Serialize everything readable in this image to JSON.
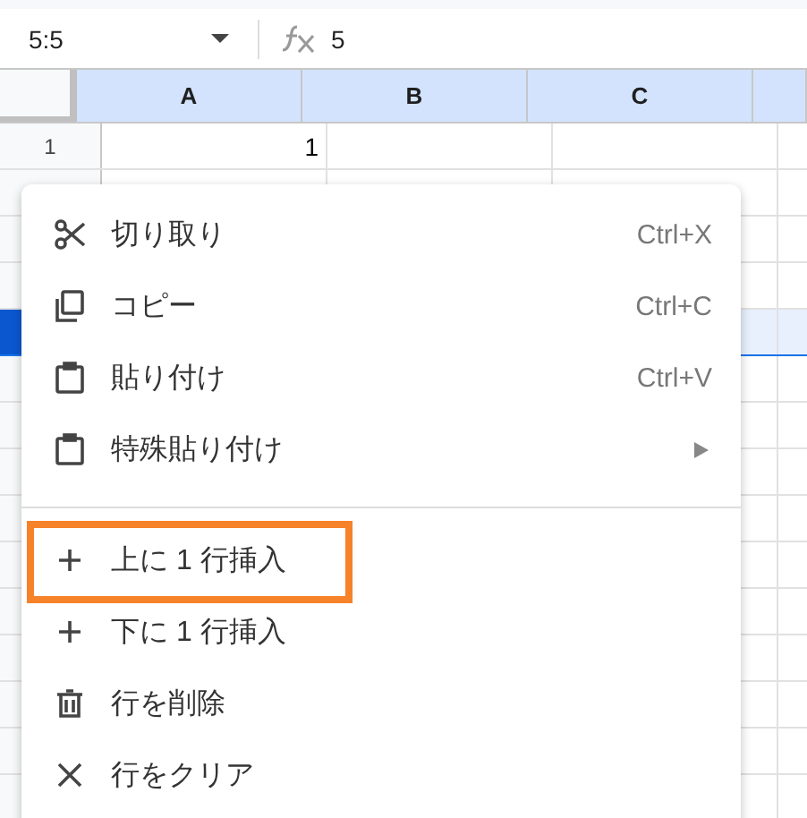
{
  "name_box": {
    "value": "5:5"
  },
  "formula_bar": {
    "value": "5"
  },
  "columns": [
    "A",
    "B",
    "C"
  ],
  "rows": [
    {
      "header": "1",
      "cells": [
        "1"
      ],
      "selected": false
    },
    {
      "selected": false
    },
    {
      "selected": false
    },
    {
      "selected": false
    },
    {
      "selected": true
    },
    {
      "selected": false
    },
    {
      "selected": false
    },
    {
      "selected": false
    },
    {
      "selected": false
    },
    {
      "selected": false
    },
    {
      "selected": false
    },
    {
      "selected": false
    },
    {
      "selected": false
    },
    {
      "selected": false
    },
    {
      "selected": false
    }
  ],
  "context_menu": {
    "items": [
      {
        "kind": "item",
        "label": "切り取り",
        "shortcut": "Ctrl+X",
        "highlighted": false
      },
      {
        "kind": "item",
        "label": "コピー",
        "shortcut": "Ctrl+C",
        "highlighted": false
      },
      {
        "kind": "item",
        "label": "貼り付け",
        "shortcut": "Ctrl+V",
        "highlighted": false
      },
      {
        "kind": "submenu",
        "label": "特殊貼り付け",
        "highlighted": false
      },
      {
        "kind": "divider"
      },
      {
        "kind": "item",
        "label": "上に 1 行挿入",
        "highlighted": true
      },
      {
        "kind": "item",
        "label": "下に 1 行挿入",
        "highlighted": false
      },
      {
        "kind": "item",
        "label": "行を削除",
        "highlighted": false
      },
      {
        "kind": "item",
        "label": "行をクリア",
        "highlighted": false
      }
    ]
  }
}
